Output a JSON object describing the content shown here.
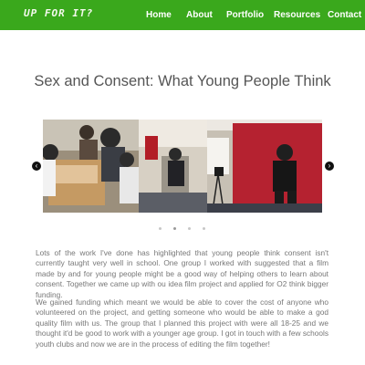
{
  "header": {
    "logo_text": "UP FOR IT?",
    "nav": [
      "Home",
      "About",
      "Portfolio",
      "Resources",
      "Contact"
    ],
    "color": "#3aa81c"
  },
  "page": {
    "title": "Sex and Consent: What Young People Think"
  },
  "slider": {
    "prev_icon": "‹",
    "next_icon": "›",
    "slide_count": 4,
    "active_slide": 2
  },
  "content": {
    "paragraphs": [
      "Lots of the work I've done has highlighted that young people think consent isn't currently taught very well in school. One group I worked with suggested that a film made by and for young people might be a good way of helping others to learn about consent. Together we came up with ou idea film project and applied for O2 think bigger funding.",
      "We gained funding which meant we would be able to cover the cost of anyone who volunteered on the project, and getting someone who would be able to make a god quality film with us. The group that I planned this project with were all 18-25 and we thought it'd be good to work with a younger age group. I got in touch with a few schools youth clubs and now we are in the process of editing the film together!"
    ]
  }
}
